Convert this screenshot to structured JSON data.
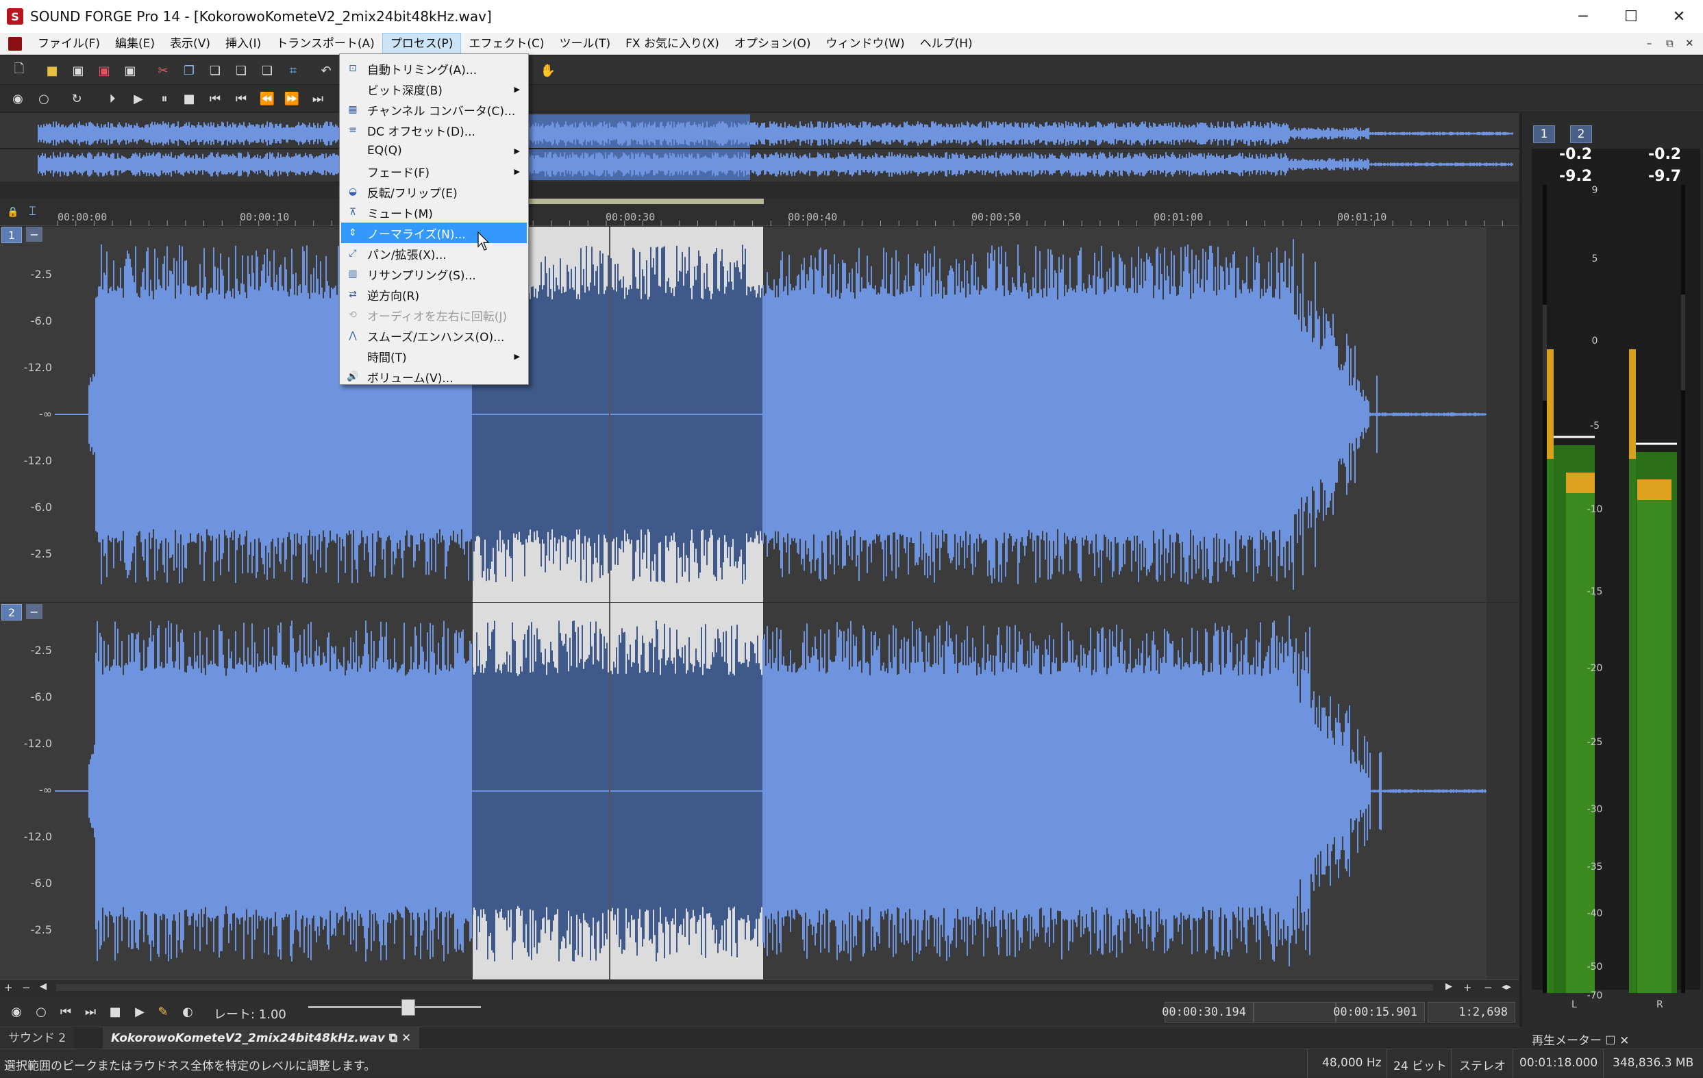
{
  "window": {
    "title": "SOUND FORGE Pro 14 - [KokorowoKometeV2_2mix24bit48kHz.wav]",
    "minimize": "─",
    "maximize": "☐",
    "close": "✕"
  },
  "menubar": {
    "items": [
      "ファイル(F)",
      "編集(E)",
      "表示(V)",
      "挿入(I)",
      "トランスポート(A)",
      "プロセス(P)",
      "エフェクト(C)",
      "ツール(T)",
      "FX お気に入り(X)",
      "オプション(O)",
      "ウィンドウ(W)",
      "ヘルプ(H)"
    ],
    "active": "プロセス(P)",
    "mdi_min": "–",
    "mdi_restore": "⧉",
    "mdi_close": "✕"
  },
  "process_menu": {
    "items": [
      {
        "label": "自動トリミング(A)...",
        "icon": "auto-trim-icon",
        "submenu": false,
        "highlighted": false,
        "disabled": false
      },
      {
        "label": "ビット深度(B)",
        "icon": "",
        "submenu": true,
        "highlighted": false,
        "disabled": false
      },
      {
        "label": "チャンネル コンバータ(C)...",
        "icon": "channel-converter-icon",
        "submenu": false,
        "highlighted": false,
        "disabled": false
      },
      {
        "label": "DC オフセット(D)...",
        "icon": "dc-offset-icon",
        "submenu": false,
        "highlighted": false,
        "disabled": false
      },
      {
        "label": "EQ(Q)",
        "icon": "",
        "submenu": true,
        "highlighted": false,
        "disabled": false
      },
      {
        "label": "フェード(F)",
        "icon": "",
        "submenu": true,
        "highlighted": false,
        "disabled": false
      },
      {
        "label": "反転/フリップ(E)",
        "icon": "invert-icon",
        "submenu": false,
        "highlighted": false,
        "disabled": false
      },
      {
        "label": "ミュート(M)",
        "icon": "mute-icon",
        "submenu": false,
        "highlighted": false,
        "disabled": false
      },
      {
        "label": "ノーマライズ(N)...",
        "icon": "normalize-icon",
        "submenu": false,
        "highlighted": true,
        "disabled": false
      },
      {
        "label": "パン/拡張(X)...",
        "icon": "pan-icon",
        "submenu": false,
        "highlighted": false,
        "disabled": false
      },
      {
        "label": "リサンプリング(S)...",
        "icon": "resample-icon",
        "submenu": false,
        "highlighted": false,
        "disabled": false
      },
      {
        "label": "逆方向(R)",
        "icon": "reverse-icon",
        "submenu": false,
        "highlighted": false,
        "disabled": false
      },
      {
        "label": "オーディオを左右に回転(J)",
        "icon": "swap-channels-icon",
        "submenu": false,
        "highlighted": false,
        "disabled": true
      },
      {
        "label": "スムーズ/エンハンス(O)...",
        "icon": "smooth-icon",
        "submenu": false,
        "highlighted": false,
        "disabled": false
      },
      {
        "label": "時間(T)",
        "icon": "",
        "submenu": true,
        "highlighted": false,
        "disabled": false
      },
      {
        "label": "ボリューム(V)...",
        "icon": "volume-icon",
        "submenu": false,
        "highlighted": false,
        "disabled": false
      }
    ]
  },
  "ruler": {
    "labels": [
      "00:00:00",
      "00:00:10",
      "00:00:30",
      "00:00:40",
      "00:00:50",
      "00:01:00",
      "00:01:10"
    ]
  },
  "channels": [
    {
      "number": "1",
      "db_labels": [
        "-2.5",
        "-6.0",
        "-12.0",
        "-∞",
        "-12.0",
        "-6.0",
        "-2.5"
      ]
    },
    {
      "number": "2",
      "db_labels": [
        "-2.5",
        "-6.0",
        "-12.0",
        "-∞",
        "-12.0",
        "-6.0",
        "-2.5"
      ]
    }
  ],
  "transport": {
    "rate": "レート: 1.00",
    "position": "00:00:30.194",
    "selection_length": "00:00:15.901",
    "zoom": "1:2,698"
  },
  "tabs": {
    "sound": "サウンド 2",
    "file": "KokorowoKometeV2_2mix24bit48kHz.wav"
  },
  "status": {
    "message": "選択範囲のピークまたはラウドネス全体を特定のレベルに調整します。",
    "sample_rate": "48,000 Hz",
    "bit_depth": "24 ビット",
    "channels": "ステレオ",
    "length": "00:01:18.000",
    "size": "348,836.3 MB"
  },
  "meter": {
    "btn1": "1",
    "btn2": "2",
    "left_peak": "-0.2",
    "right_peak": "-0.2",
    "left_rms": "-9.2",
    "right_rms": "-9.7",
    "scale": [
      "9",
      "5",
      "0",
      "-5",
      "-10",
      "-15",
      "-20",
      "-25",
      "-30",
      "-35",
      "-40",
      "-50",
      "-70"
    ],
    "left_label": "L",
    "right_label": "R",
    "title": "再生メーター"
  },
  "colors": {
    "waveform": "#6e94e0",
    "selection_bg": "#dcdcdc",
    "selection_wave": "#3f5a8a",
    "menu_highlight": "#3399ff"
  }
}
